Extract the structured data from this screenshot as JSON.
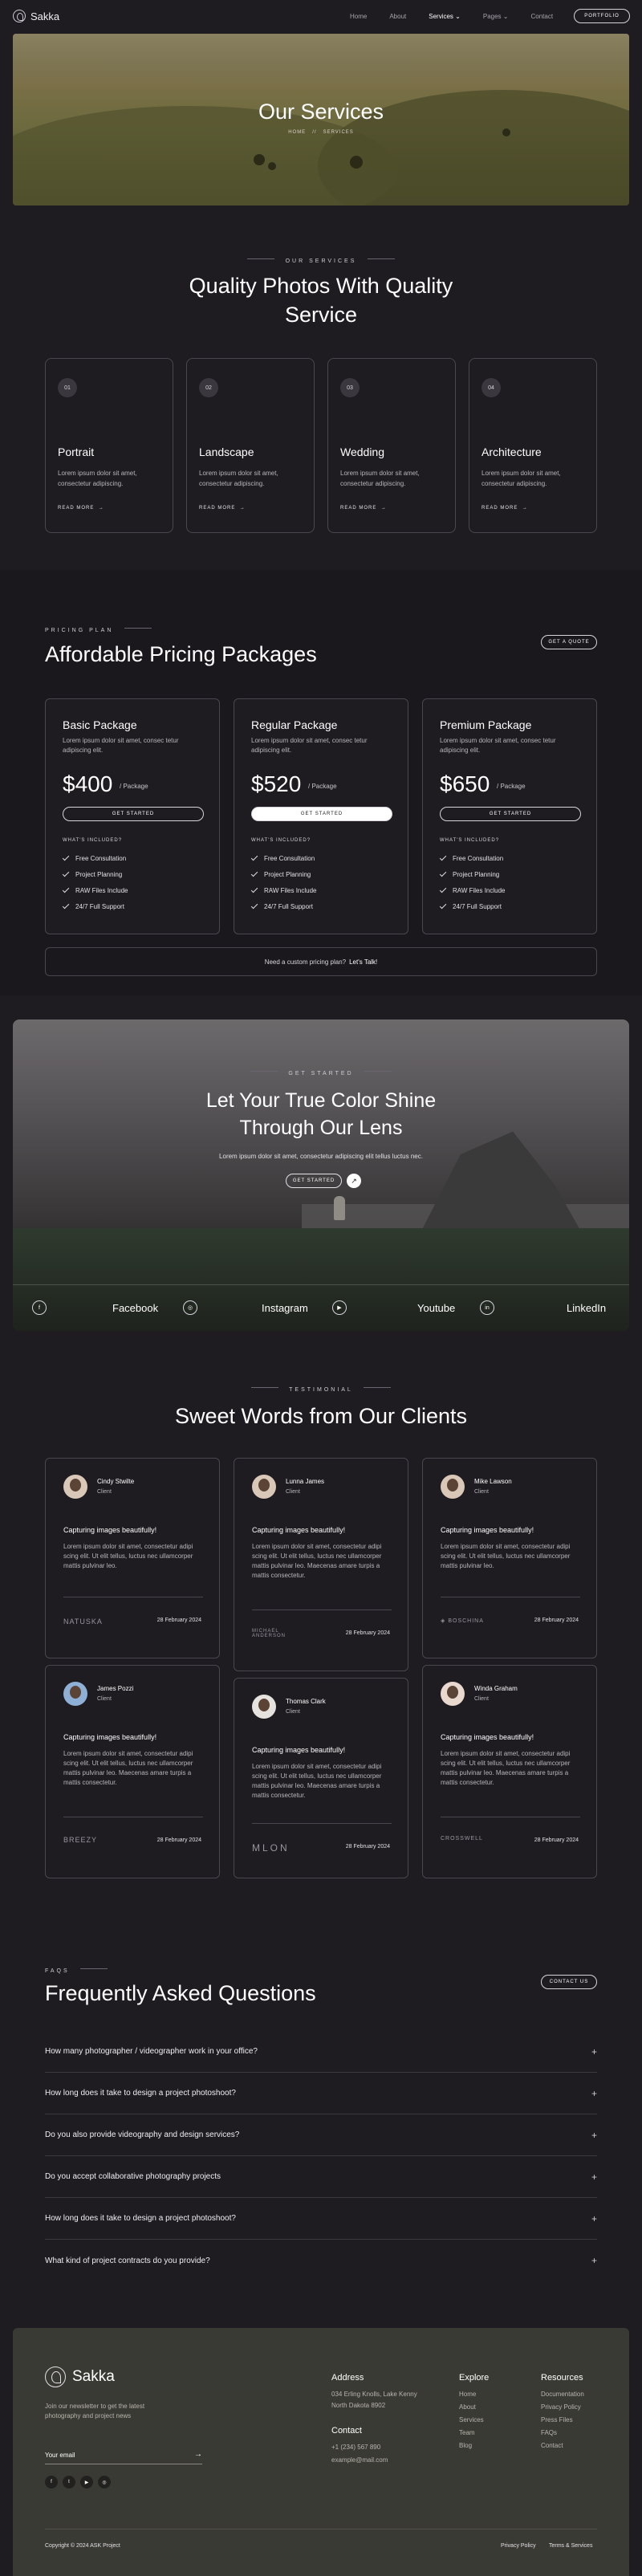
{
  "nav": {
    "brand": "Sakka",
    "links": [
      "Home",
      "About",
      "Services",
      "Pages",
      "Contact"
    ],
    "active": "Services",
    "cta": "PORTFOLIO"
  },
  "hero": {
    "title": "Our Services",
    "breadcrumb": [
      "HOME",
      "//",
      "SERVICES"
    ]
  },
  "services": {
    "eyebrow": "OUR SERVICES",
    "title_line1": "Quality Photos With Quality",
    "title_line2": "Service",
    "items": [
      {
        "num": "01",
        "title": "Portrait",
        "desc": "Lorem ipsum dolor sit amet, consectetur adipiscing.",
        "link": "READ MORE"
      },
      {
        "num": "02",
        "title": "Landscape",
        "desc": "Lorem ipsum dolor sit amet, consectetur adipiscing.",
        "link": "READ MORE"
      },
      {
        "num": "03",
        "title": "Wedding",
        "desc": "Lorem ipsum dolor sit amet, consectetur adipiscing.",
        "link": "READ MORE"
      },
      {
        "num": "04",
        "title": "Architecture",
        "desc": "Lorem ipsum dolor sit amet, consectetur adipiscing.",
        "link": "READ MORE"
      }
    ]
  },
  "pricing": {
    "eyebrow": "PRICING PLAN",
    "title": "Affordable Pricing Packages",
    "quote_button": "GET A QUOTE",
    "plans": [
      {
        "name": "Basic Package",
        "desc": "Lorem ipsum dolor sit amet, consec tetur adipiscing elit.",
        "price": "$400",
        "per": "/ Package",
        "cta": "GET STARTED",
        "included": "WHAT'S INCLUDED?",
        "features": [
          "Free Consultation",
          "Project Planning",
          "RAW Files Include",
          "24/7 Full Support"
        ]
      },
      {
        "name": "Regular Package",
        "desc": "Lorem ipsum dolor sit amet, consec tetur adipiscing elit.",
        "price": "$520",
        "per": "/ Package",
        "cta": "GET STARTED",
        "included": "WHAT'S INCLUDED?",
        "features": [
          "Free Consultation",
          "Project Planning",
          "RAW Files Include",
          "24/7 Full Support"
        ]
      },
      {
        "name": "Premium Package",
        "desc": "Lorem ipsum dolor sit amet, consec tetur adipiscing elit.",
        "price": "$650",
        "per": "/ Package",
        "cta": "GET STARTED",
        "included": "WHAT'S INCLUDED?",
        "features": [
          "Free Consultation",
          "Project Planning",
          "RAW Files Include",
          "24/7 Full Support"
        ]
      }
    ],
    "custom_text": "Need a custom pricing plan?",
    "custom_link": "Let's Talk!"
  },
  "cta": {
    "eyebrow": "GET STARTED",
    "title_line1": "Let Your True Color Shine",
    "title_line2": "Through Our Lens",
    "subtitle": "Lorem ipsum dolor sit amet, consectetur adipiscing elit tellus luctus nec.",
    "button": "GET STARTED",
    "socials": [
      {
        "icon": "f",
        "name": "Facebook"
      },
      {
        "icon": "◎",
        "name": "Instagram"
      },
      {
        "icon": "▶",
        "name": "Youtube"
      },
      {
        "icon": "in",
        "name": "LinkedIn"
      }
    ]
  },
  "testimonials": {
    "eyebrow": "TESTIMONIAL",
    "title": "Sweet Words from Our Clients",
    "items": [
      {
        "name": "Cindy Stwilte",
        "role": "Client",
        "quote": "Capturing images beautifully!",
        "text": "Lorem ipsum dolor sit amet, consectetur adipi scing elit. Ut elit tellus, luctus nec ullamcorper mattis pulvinar leo.",
        "brand": "NATUSKA",
        "date": "28 February 2024"
      },
      {
        "name": "Lunna James",
        "role": "Client",
        "quote": "Capturing images beautifully!",
        "text": "Lorem ipsum dolor sit amet, consectetur adipi scing elit. Ut elit tellus, luctus nec ullamcorper mattis pulvinar leo. Maecenas amare turpis a mattis consectetur.",
        "brand": "MICHAEL ANDERSON",
        "date": "28 February 2024"
      },
      {
        "name": "Mike Lawson",
        "role": "Client",
        "quote": "Capturing images beautifully!",
        "text": "Lorem ipsum dolor sit amet, consectetur adipi scing elit. Ut elit tellus, luctus nec ullamcorper mattis pulvinar leo.",
        "brand": "◈ BOSCHINA",
        "date": "28 February 2024"
      },
      {
        "name": "James Pozzi",
        "role": "Client",
        "quote": "Capturing images beautifully!",
        "text": "Lorem ipsum dolor sit amet, consectetur adipi scing elit. Ut elit tellus, luctus nec ullamcorper mattis pulvinar leo. Maecenas amare turpis a mattis consectetur.",
        "brand": "BREEZY",
        "date": "28 February 2024"
      },
      {
        "name": "Thomas Clark",
        "role": "Client",
        "quote": "Capturing images beautifully!",
        "text": "Lorem ipsum dolor sit amet, consectetur adipi scing elit. Ut elit tellus, luctus nec ullamcorper mattis pulvinar leo. Maecenas amare turpis a mattis consectetur.",
        "brand": "MLON",
        "date": "28 February 2024"
      },
      {
        "name": "Winda Graham",
        "role": "Client",
        "quote": "Capturing images beautifully!",
        "text": "Lorem ipsum dolor sit amet, consectetur adipi scing elit. Ut elit tellus, luctus nec ullamcorper mattis pulvinar leo. Maecenas amare turpis a mattis consectetur.",
        "brand": "CROSSWELL",
        "date": "28 February 2024"
      }
    ]
  },
  "faq": {
    "eyebrow": "FAQS",
    "title": "Frequently Asked Questions",
    "contact_button": "CONTACT US",
    "items": [
      "How many photographer / videographer work in your office?",
      "How long does it take to design a project photoshoot?",
      "Do you also provide videography and design services?",
      "Do you accept collaborative photography projects",
      "How long does it take to design a project photoshoot?",
      "What kind of project contracts do you provide?"
    ]
  },
  "footer": {
    "brand": "Sakka",
    "newsletter": "Join our newsletter to get the latest photography and project news",
    "email_placeholder": "Your email",
    "socials": [
      "f",
      "t",
      "▶",
      "◎"
    ],
    "address_title": "Address",
    "address_line1": "034 Erling Knolls, Lake Kenny",
    "address_line2": "North Dakota 8902",
    "contact_title": "Contact",
    "phone": "+1 (234) 567 890",
    "email": "example@mail.com",
    "explore_title": "Explore",
    "explore": [
      "Home",
      "About",
      "Services",
      "Team",
      "Blog"
    ],
    "resources_title": "Resources",
    "resources": [
      "Documentation",
      "Privacy Policy",
      "Press Files",
      "FAQs",
      "Contact"
    ],
    "copyright": "Copyright © 2024 ASK Project",
    "privacy": "Privacy Policy",
    "terms": "Terms & Services"
  }
}
